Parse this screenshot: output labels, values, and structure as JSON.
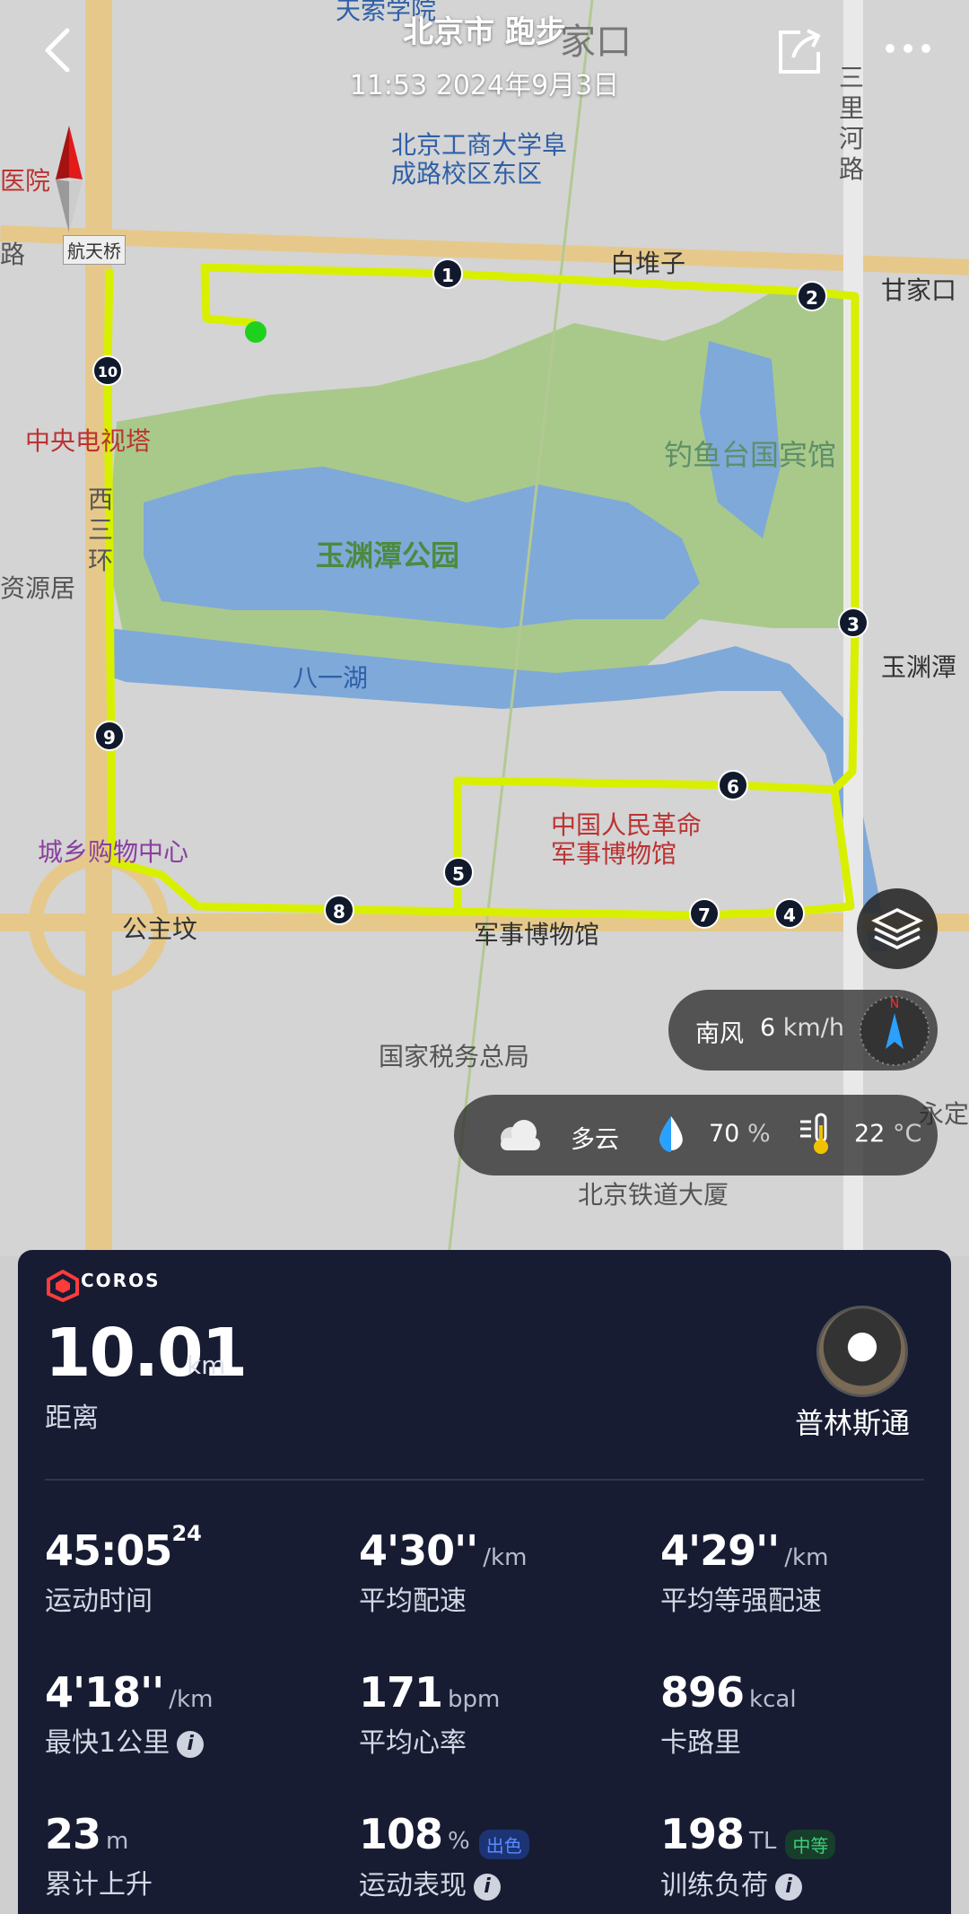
{
  "header": {
    "title": "北京市 跑步",
    "datetime": "11:53 2024年9月3日"
  },
  "map": {
    "labels": {
      "bldg1": "北京工商大学阜",
      "bldg1b": "成路校区东区",
      "hangtianqiao": "航天桥",
      "baiduizi": "白堆子",
      "ganjiakou": "甘家口",
      "cctv": "中央电视塔",
      "diaoyutai": "钓鱼台国宾馆",
      "yuyuantan": "玉渊潭公园",
      "bayihu": "八一湖",
      "yuyuantan_st": "玉渊潭",
      "xisanhuan": "西三环",
      "sanlihe": "三里河路",
      "museum1": "中国人民革命",
      "museum2": "军事博物馆",
      "mall": "城乡购物中心",
      "gongzhufen": "公主坟",
      "junbo": "军事博物馆",
      "tax": "国家税务总局",
      "railway": "北京铁道大厦",
      "hospital": "医院",
      "road": "路",
      "ziyuan": "资源居",
      "tianyu": "天索学院",
      "yongding": "永定",
      "jiakou": "家口"
    },
    "km_markers": [
      "1",
      "2",
      "3",
      "4",
      "5",
      "6",
      "7",
      "8",
      "9",
      "10"
    ]
  },
  "wind": {
    "label": "南风",
    "value": "6",
    "unit": "km/h"
  },
  "weather": {
    "condition": "多云",
    "humidity": "70",
    "humidity_unit": "%",
    "temp": "22",
    "temp_unit": "°C"
  },
  "stats": {
    "brand": "COROS",
    "distance": "10.01",
    "distance_unit": "km",
    "distance_label": "距离",
    "user_name": "普林斯通",
    "time_main": "45:05",
    "time_sup": "24",
    "time_label": "运动时间",
    "pace": "4'30''",
    "pace_unit": "/km",
    "pace_label": "平均配速",
    "grade_pace": "4'29''",
    "grade_pace_unit": "/km",
    "grade_pace_label": "平均等强配速",
    "fastest_km": "4'18''",
    "fastest_km_unit": "/km",
    "fastest_km_label": "最快1公里",
    "hr": "171",
    "hr_unit": "bpm",
    "hr_label": "平均心率",
    "calories": "896",
    "calories_unit": "kcal",
    "calories_label": "卡路里",
    "ascent": "23",
    "ascent_unit": "m",
    "ascent_label": "累计上升",
    "performance": "108",
    "performance_unit": "%",
    "performance_badge": "出色",
    "performance_label": "运动表现",
    "load": "198",
    "load_unit": "TL",
    "load_badge": "中等",
    "load_label": "训练负荷"
  }
}
